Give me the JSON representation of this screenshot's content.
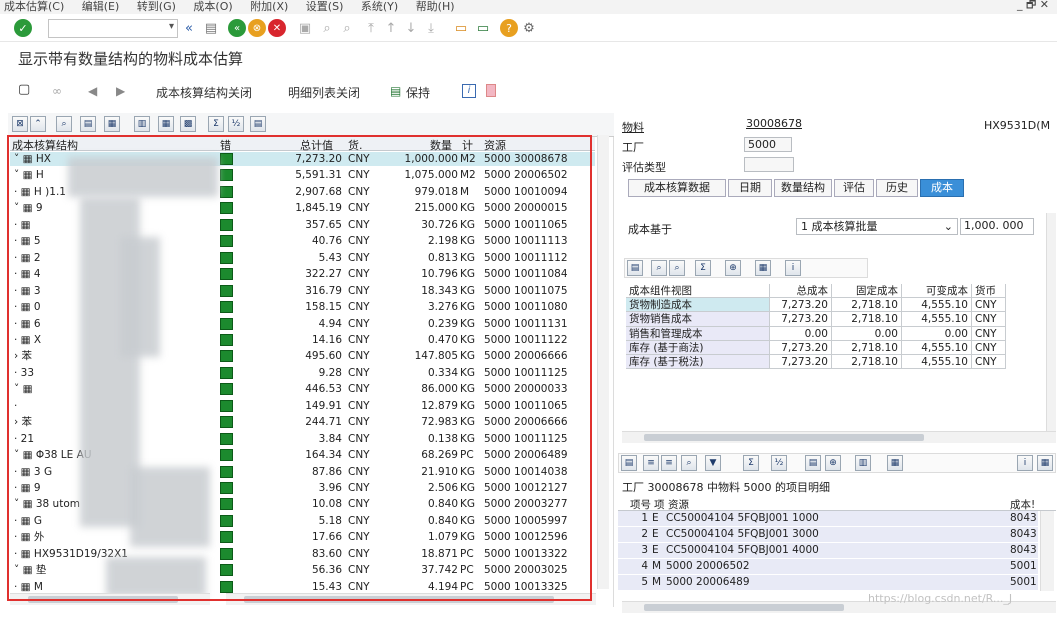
{
  "menu": [
    "成本估算(C)",
    "编辑(E)",
    "转到(G)",
    "成本(O)",
    "附加(X)",
    "设置(S)",
    "系统(Y)",
    "帮助(H)"
  ],
  "window_controls": "_ 🗗 ✕",
  "page_title": "显示带有数量结构的物料成本估算",
  "toolbar2": {
    "item1": "成本核算结构关闭",
    "item2": "明细列表关闭",
    "item3": "保持"
  },
  "left_grid": {
    "headers": {
      "tree": "成本核算结构",
      "err": "错",
      "total": "总计值",
      "cur": "货.",
      "qty": "数量",
      "unit": "计",
      "resource": "资源"
    },
    "rows": [
      {
        "tree": "˅ ▦ HX",
        "total": "7,273.20",
        "cur": "CNY",
        "qty": "1,000.000",
        "unit": "M2",
        "res": "5000 30008678"
      },
      {
        "tree": "  ˅ ▦ H",
        "total": "5,591.31",
        "cur": "CNY",
        "qty": "1,075.000",
        "unit": "M2",
        "res": "5000 20006502"
      },
      {
        "tree": "    · ▦ H                    )1.1",
        "total": "2,907.68",
        "cur": "CNY",
        "qty": "979.018",
        "unit": "M",
        "res": "5000 10010094"
      },
      {
        "tree": "    ˅ ▦ 9",
        "total": "1,845.19",
        "cur": "CNY",
        "qty": "215.000",
        "unit": "KG",
        "res": "5000 20000015"
      },
      {
        "tree": "      · ▦",
        "total": "357.65",
        "cur": "CNY",
        "qty": "30.726",
        "unit": "KG",
        "res": "5000 10011065"
      },
      {
        "tree": "      · ▦         5",
        "total": "40.76",
        "cur": "CNY",
        "qty": "2.198",
        "unit": "KG",
        "res": "5000 10011113"
      },
      {
        "tree": "      · ▦         2",
        "total": "5.43",
        "cur": "CNY",
        "qty": "0.813",
        "unit": "KG",
        "res": "5000 10011112"
      },
      {
        "tree": "      · ▦         4",
        "total": "322.27",
        "cur": "CNY",
        "qty": "10.796",
        "unit": "KG",
        "res": "5000 10011084"
      },
      {
        "tree": "      · ▦         3",
        "total": "316.79",
        "cur": "CNY",
        "qty": "18.343",
        "unit": "KG",
        "res": "5000 10011075"
      },
      {
        "tree": "      · ▦         0",
        "total": "158.15",
        "cur": "CNY",
        "qty": "3.276",
        "unit": "KG",
        "res": "5000 10011080"
      },
      {
        "tree": "      · ▦         6",
        "total": "4.94",
        "cur": "CNY",
        "qty": "0.239",
        "unit": "KG",
        "res": "5000 10011131"
      },
      {
        "tree": "      · ▦       X",
        "total": "14.16",
        "cur": "CNY",
        "qty": "0.470",
        "unit": "KG",
        "res": "5000 10011122"
      },
      {
        "tree": "      ›        苯",
        "total": "495.60",
        "cur": "CNY",
        "qty": "147.805",
        "unit": "KG",
        "res": "5000 20006666"
      },
      {
        "tree": "      ·       33",
        "total": "9.28",
        "cur": "CNY",
        "qty": "0.334",
        "unit": "KG",
        "res": "5000 10011125"
      },
      {
        "tree": "    ˅ ▦",
        "total": "446.53",
        "cur": "CNY",
        "qty": "86.000",
        "unit": "KG",
        "res": "5000 20000033"
      },
      {
        "tree": "      ·",
        "total": "149.91",
        "cur": "CNY",
        "qty": "12.879",
        "unit": "KG",
        "res": "5000 10011065"
      },
      {
        "tree": "      ›          苯",
        "total": "244.71",
        "cur": "CNY",
        "qty": "72.983",
        "unit": "KG",
        "res": "5000 20006666"
      },
      {
        "tree": "      ·         21",
        "total": "3.84",
        "cur": "CNY",
        "qty": "0.138",
        "unit": "KG",
        "res": "5000 10011125"
      },
      {
        "tree": "  ˅ ▦ Φ38                  LE AU",
        "total": "164.34",
        "cur": "CNY",
        "qty": "68.269",
        "unit": "PC",
        "res": "5000 20006489"
      },
      {
        "tree": "    · ▦ 3                      G",
        "total": "87.86",
        "cur": "CNY",
        "qty": "21.910",
        "unit": "KG",
        "res": "5000 10014038"
      },
      {
        "tree": "    · ▦ 9",
        "total": "3.96",
        "cur": "CNY",
        "qty": "2.506",
        "unit": "KG",
        "res": "5000 10012127"
      },
      {
        "tree": "    ˅ ▦ 38                  utom",
        "total": "10.08",
        "cur": "CNY",
        "qty": "0.840",
        "unit": "KG",
        "res": "5000 20003277"
      },
      {
        "tree": "      · ▦                   G",
        "total": "5.18",
        "cur": "CNY",
        "qty": "0.840",
        "unit": "KG",
        "res": "5000 10005997"
      },
      {
        "tree": "    · ▦ 外",
        "total": "17.66",
        "cur": "CNY",
        "qty": "1.079",
        "unit": "KG",
        "res": "5000 10012596"
      },
      {
        "tree": "  · ▦           HX9531D19/32X1",
        "total": "83.60",
        "cur": "CNY",
        "qty": "18.871",
        "unit": "PC",
        "res": "5000 10013322"
      },
      {
        "tree": "  ˅ ▦ 垫",
        "total": "56.36",
        "cur": "CNY",
        "qty": "37.742",
        "unit": "PC",
        "res": "5000 20003025"
      },
      {
        "tree": "    · ▦                    M",
        "total": "15.43",
        "cur": "CNY",
        "qty": "4.194",
        "unit": "PC",
        "res": "5000 10013325"
      }
    ]
  },
  "right": {
    "material_label": "物料",
    "material_value": "30008678",
    "material_desc": "HX9531D(M",
    "plant_label": "工厂",
    "plant_value": "5000",
    "valtype_label": "评估类型",
    "tabs": [
      "成本核算数据",
      "日期",
      "数量结构",
      "评估",
      "历史",
      "成本"
    ],
    "basis_label": "成本基于",
    "basis_value": "1 成本核算批量",
    "basis_qty": "1,000. 000",
    "ctable": {
      "headers": [
        "成本组件视图",
        "总成本",
        "固定成本",
        "可变成本",
        "货币"
      ],
      "rows": [
        [
          "货物制造成本",
          "7,273.20",
          "2,718.10",
          "4,555.10",
          "CNY"
        ],
        [
          "货物销售成本",
          "7,273.20",
          "2,718.10",
          "4,555.10",
          "CNY"
        ],
        [
          "销售和管理成本",
          "0.00",
          "0.00",
          "0.00",
          "CNY"
        ],
        [
          "库存 (基于商法)",
          "7,273.20",
          "2,718.10",
          "4,555.10",
          "CNY"
        ],
        [
          "库存 (基于税法)",
          "7,273.20",
          "2,718.10",
          "4,555.10",
          "CNY"
        ]
      ]
    },
    "items_title": "工厂 30008678 中物料 5000 的项目明细",
    "items_headers": {
      "no": "项号",
      "cat": "项",
      "res": "资源",
      "cost": "成本!"
    },
    "items": [
      {
        "no": "1",
        "cat": "E",
        "res": "CC50004104 5FQBJ001 1000",
        "cost": "8043"
      },
      {
        "no": "2",
        "cat": "E",
        "res": "CC50004104 5FQBJ001 3000",
        "cost": "8043"
      },
      {
        "no": "3",
        "cat": "E",
        "res": "CC50004104 5FQBJ001 4000",
        "cost": "8043"
      },
      {
        "no": "4",
        "cat": "M",
        "res": "5000 20006502",
        "cost": "5001"
      },
      {
        "no": "5",
        "cat": "M",
        "res": "5000 20006489",
        "cost": "5001"
      }
    ]
  },
  "watermark": "https://blog.csdn.net/R..._J",
  "colors": {
    "accent": "#3a8fd8",
    "lamp": "#1c8a2e",
    "selection": "#cfeaf0",
    "highlight_box": "#e0302e"
  }
}
